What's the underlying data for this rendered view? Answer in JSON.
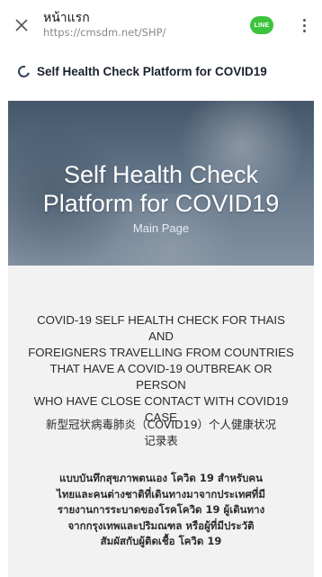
{
  "browser": {
    "title": "หน้าแรก",
    "url": "https://cmsdm.net/SHP/",
    "line_label": "LINE"
  },
  "site": {
    "title": "Self Health Check Platform for COVID19"
  },
  "hero": {
    "title_line1": "Self Health Check",
    "title_line2": "Platform for COVID19",
    "subtitle": "Main Page"
  },
  "content": {
    "english_lines": [
      "COVID-19 SELF HEALTH CHECK FOR THAIS AND",
      "FOREIGNERS TRAVELLING FROM COUNTRIES",
      "THAT HAVE A COVID-19 OUTBREAK OR PERSON",
      "WHO HAVE CLOSE CONTACT WITH COVID19",
      "CASE"
    ],
    "chinese_lines": [
      "新型冠状病毒肺炎（COVID19）个人健康状况",
      "记录表"
    ],
    "thai_lines": [
      "แบบบันทึกสุขภาพตนเอง โควิด 19 สำหรับคน",
      "ไทยและคนต่างชาติที่เดินทางมาจากประเทศที่มี",
      "รายงานการระบาดของโรคโควิด 19 ผู้เดินทาง",
      "จากกรุงเทพและปริมณฑล หรือผู้ที่มีประวัติ",
      "สัมผัสกับผู้ติดเชื้อ โควิด 19"
    ]
  },
  "colors": {
    "line_green": "#3dc43d",
    "content_bg": "#f2f2f2",
    "hero_tint": "#6c8196"
  }
}
